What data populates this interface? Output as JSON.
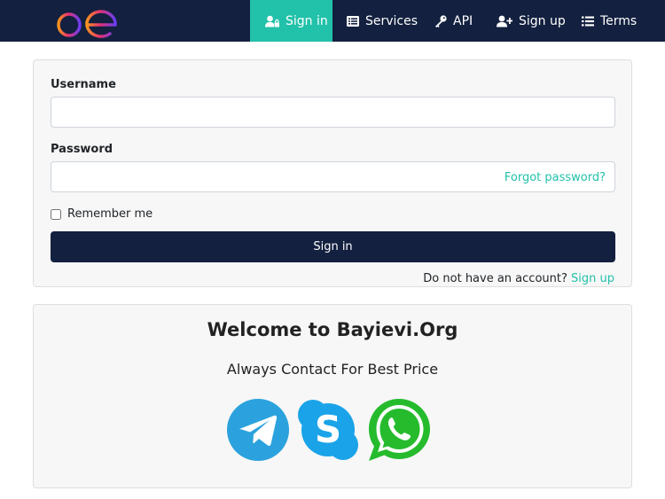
{
  "nav": {
    "logo_text": "be",
    "items": [
      {
        "label": "Sign in",
        "icon": "user-lock-icon"
      },
      {
        "label": "Services",
        "icon": "list-box-icon"
      },
      {
        "label": "API",
        "icon": "key-icon"
      },
      {
        "label": "Sign up",
        "icon": "user-plus-icon"
      },
      {
        "label": "Terms",
        "icon": "list-icon"
      }
    ]
  },
  "login": {
    "username_label": "Username",
    "username_value": "",
    "password_label": "Password",
    "password_value": "",
    "forgot_password": "Forgot password?",
    "remember_me": "Remember me",
    "submit_label": "Sign in",
    "no_account_text": "Do not have an account?",
    "signup_link": "Sign up"
  },
  "welcome": {
    "title": "Welcome to Bayievi.Org",
    "subtitle": "Always Contact For Best Price",
    "social": [
      "telegram-icon",
      "skype-icon",
      "whatsapp-icon"
    ]
  },
  "colors": {
    "navbar": "#13203f",
    "accent": "#22c1a9",
    "telegram": "#2ba2dd",
    "skype": "#1aa3e8",
    "whatsapp": "#25bb2d"
  }
}
